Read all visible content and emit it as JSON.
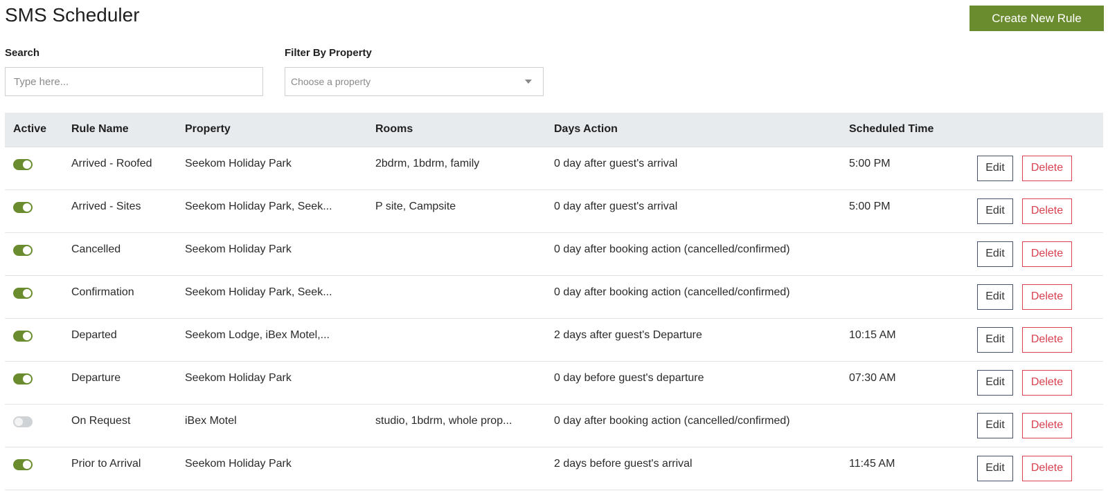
{
  "header": {
    "title": "SMS Scheduler",
    "create_label": "Create New Rule"
  },
  "filters": {
    "search_label": "Search",
    "search_placeholder": "Type here...",
    "property_label": "Filter By Property",
    "property_placeholder": "Choose a property"
  },
  "table": {
    "columns": [
      "Active",
      "Rule Name",
      "Property",
      "Rooms",
      "Days Action",
      "Scheduled Time",
      ""
    ],
    "edit_label": "Edit",
    "delete_label": "Delete",
    "rows": [
      {
        "active": true,
        "name": "Arrived - Roofed",
        "property": "Seekom Holiday Park",
        "rooms": "2bdrm, 1bdrm, family",
        "days_action": "0 day after guest's arrival",
        "time": "5:00 PM"
      },
      {
        "active": true,
        "name": "Arrived - Sites",
        "property": "Seekom Holiday Park, Seek...",
        "rooms": "P site, Campsite",
        "days_action": "0 day after guest's arrival",
        "time": "5:00 PM"
      },
      {
        "active": true,
        "name": "Cancelled",
        "property": "Seekom Holiday Park",
        "rooms": "",
        "days_action": "0 day after booking action (cancelled/confirmed)",
        "time": ""
      },
      {
        "active": true,
        "name": "Confirmation",
        "property": "Seekom Holiday Park, Seek...",
        "rooms": "",
        "days_action": "0 day after booking action (cancelled/confirmed)",
        "time": ""
      },
      {
        "active": true,
        "name": "Departed",
        "property": "Seekom Lodge, iBex Motel,...",
        "rooms": "",
        "days_action": "2 days after guest's Departure",
        "time": "10:15 AM"
      },
      {
        "active": true,
        "name": "Departure",
        "property": "Seekom Holiday Park",
        "rooms": "",
        "days_action": "0 day before guest's departure",
        "time": "07:30 AM"
      },
      {
        "active": false,
        "name": "On Request",
        "property": "iBex Motel",
        "rooms": "studio, 1bdrm, whole prop...",
        "days_action": "0 day after booking action (cancelled/confirmed)",
        "time": ""
      },
      {
        "active": true,
        "name": "Prior to Arrival",
        "property": "Seekom Holiday Park",
        "rooms": "",
        "days_action": "2 days before guest's arrival",
        "time": "11:45 AM"
      }
    ]
  },
  "colors": {
    "accent": "#6b8c2e",
    "delete": "#d9404f",
    "header_bg": "#e8ebee"
  }
}
